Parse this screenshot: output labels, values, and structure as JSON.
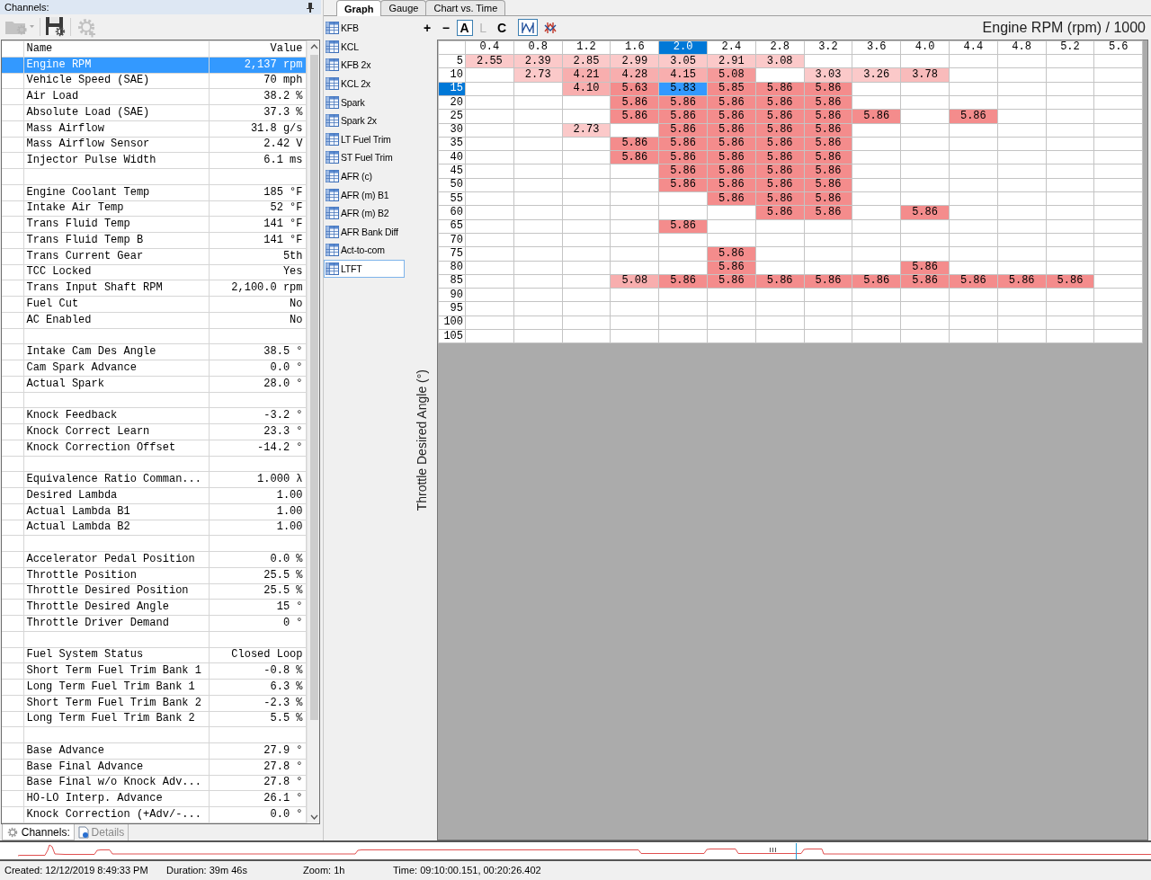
{
  "channels_panel": {
    "title": "Channels:",
    "toolbar": [
      {
        "kind": "folder",
        "disabled": true
      },
      {
        "kind": "save",
        "disabled": false
      },
      {
        "kind": "gear",
        "disabled": true
      }
    ],
    "columns": [
      "Name",
      "Value"
    ],
    "rows": [
      {
        "kind": "channel",
        "name": "Engine RPM",
        "value": "2,137 rpm",
        "selected": true
      },
      {
        "kind": "channel",
        "name": "Vehicle Speed (SAE)",
        "value": "70 mph",
        "selected": false
      },
      {
        "kind": "channel",
        "name": "Air Load",
        "value": "38.2 %",
        "selected": false
      },
      {
        "kind": "channel",
        "name": "Absolute Load (SAE)",
        "value": "37.3 %",
        "selected": false
      },
      {
        "kind": "channel",
        "name": "Mass Airflow",
        "value": "31.8 g/s",
        "selected": false
      },
      {
        "kind": "channel",
        "name": "Mass Airflow Sensor",
        "value": "2.42 V",
        "selected": false
      },
      {
        "kind": "channel",
        "name": "Injector Pulse Width",
        "value": "6.1 ms",
        "selected": false
      },
      {
        "kind": "spacer"
      },
      {
        "kind": "channel",
        "name": "Engine Coolant Temp",
        "value": "185 °F",
        "selected": false
      },
      {
        "kind": "channel",
        "name": "Intake Air Temp",
        "value": "52 °F",
        "selected": false
      },
      {
        "kind": "channel",
        "name": "Trans Fluid Temp",
        "value": "141 °F",
        "selected": false
      },
      {
        "kind": "channel",
        "name": "Trans Fluid Temp B",
        "value": "141 °F",
        "selected": false
      },
      {
        "kind": "channel",
        "name": "Trans Current Gear",
        "value": "5th",
        "selected": false
      },
      {
        "kind": "channel",
        "name": "TCC Locked",
        "value": "Yes",
        "selected": false
      },
      {
        "kind": "channel",
        "name": "Trans Input Shaft RPM",
        "value": "2,100.0 rpm",
        "selected": false
      },
      {
        "kind": "channel",
        "name": "Fuel Cut",
        "value": "No",
        "selected": false
      },
      {
        "kind": "channel",
        "name": "AC Enabled",
        "value": "No",
        "selected": false
      },
      {
        "kind": "spacer"
      },
      {
        "kind": "channel",
        "name": "Intake Cam Des Angle",
        "value": "38.5 °",
        "selected": false
      },
      {
        "kind": "channel",
        "name": "Cam Spark Advance",
        "value": "0.0 °",
        "selected": false
      },
      {
        "kind": "channel",
        "name": "Actual Spark",
        "value": "28.0 °",
        "selected": false
      },
      {
        "kind": "spacer"
      },
      {
        "kind": "channel",
        "name": "Knock Feedback",
        "value": "-3.2 °",
        "selected": false
      },
      {
        "kind": "channel",
        "name": "Knock Correct Learn",
        "value": "23.3 °",
        "selected": false
      },
      {
        "kind": "channel",
        "name": "Knock Correction Offset",
        "value": "-14.2 °",
        "selected": false
      },
      {
        "kind": "spacer"
      },
      {
        "kind": "channel",
        "name": "Equivalence Ratio Comman...",
        "value": "1.000 λ",
        "selected": false
      },
      {
        "kind": "channel",
        "name": "Desired Lambda",
        "value": "1.00",
        "selected": false
      },
      {
        "kind": "channel",
        "name": "Actual Lambda B1",
        "value": "1.00",
        "selected": false
      },
      {
        "kind": "channel",
        "name": "Actual Lambda B2",
        "value": "1.00",
        "selected": false
      },
      {
        "kind": "spacer"
      },
      {
        "kind": "channel",
        "name": "Accelerator Pedal Position",
        "value": "0.0 %",
        "selected": false
      },
      {
        "kind": "channel",
        "name": "Throttle Position",
        "value": "25.5 %",
        "selected": false
      },
      {
        "kind": "channel",
        "name": "Throttle Desired Position",
        "value": "25.5 %",
        "selected": false
      },
      {
        "kind": "channel",
        "name": "Throttle Desired Angle",
        "value": "15 °",
        "selected": false
      },
      {
        "kind": "channel",
        "name": "Throttle Driver Demand",
        "value": "0 °",
        "selected": false
      },
      {
        "kind": "spacer"
      },
      {
        "kind": "channel",
        "name": "Fuel System Status",
        "value": "Closed Loop",
        "selected": false
      },
      {
        "kind": "channel",
        "name": "Short Term Fuel Trim Bank 1",
        "value": "-0.8 %",
        "selected": false
      },
      {
        "kind": "channel",
        "name": "Long Term Fuel Trim Bank 1",
        "value": "6.3 %",
        "selected": false
      },
      {
        "kind": "channel",
        "name": "Short Term Fuel Trim Bank 2",
        "value": "-2.3 %",
        "selected": false
      },
      {
        "kind": "channel",
        "name": "Long Term Fuel Trim Bank 2",
        "value": "5.5 %",
        "selected": false
      },
      {
        "kind": "spacer"
      },
      {
        "kind": "channel",
        "name": "Base Advance",
        "value": "27.9 °",
        "selected": false
      },
      {
        "kind": "channel",
        "name": "Base Final Advance",
        "value": "27.8 °",
        "selected": false
      },
      {
        "kind": "channel",
        "name": "Base Final w/o Knock Adv...",
        "value": "27.8 °",
        "selected": false
      },
      {
        "kind": "channel",
        "name": "HO-LO Interp. Advance",
        "value": "26.1 °",
        "selected": false
      },
      {
        "kind": "channel",
        "name": "Knock Correction (+Adv/-...",
        "value": "0.0 °",
        "selected": false
      }
    ],
    "bottom_tabs": [
      {
        "label": "Channels:",
        "kind": "gear",
        "selected": true
      },
      {
        "label": "Details",
        "kind": "doc",
        "selected": false
      }
    ]
  },
  "view_tabs": [
    {
      "label": "Graph",
      "selected": true
    },
    {
      "label": "Gauge",
      "selected": false
    },
    {
      "label": "Chart vs. Time",
      "selected": false
    }
  ],
  "tables": [
    {
      "label": "KFB",
      "selected": false
    },
    {
      "label": "KCL",
      "selected": false
    },
    {
      "label": "KFB 2x",
      "selected": false
    },
    {
      "label": "KCL 2x",
      "selected": false
    },
    {
      "label": "Spark",
      "selected": false
    },
    {
      "label": "Spark 2x",
      "selected": false
    },
    {
      "label": "LT Fuel Trim",
      "selected": false
    },
    {
      "label": "ST Fuel Trim",
      "selected": false
    },
    {
      "label": "AFR (c)",
      "selected": false
    },
    {
      "label": "AFR (m) B1",
      "selected": false
    },
    {
      "label": "AFR (m) B2",
      "selected": false
    },
    {
      "label": "AFR Bank Diff",
      "selected": false
    },
    {
      "label": "Act-to-com",
      "selected": false
    },
    {
      "label": "LTFT",
      "selected": true
    }
  ],
  "graph_toolbar": [
    {
      "kind": "text",
      "label": "+",
      "selected": false,
      "disabled": false
    },
    {
      "kind": "text",
      "label": "−",
      "selected": false,
      "disabled": false
    },
    {
      "kind": "text",
      "label": "A",
      "selected": true,
      "disabled": false
    },
    {
      "kind": "text",
      "label": "L",
      "selected": false,
      "disabled": true
    },
    {
      "kind": "text",
      "label": "C",
      "selected": false,
      "disabled": false
    },
    {
      "kind": "lines",
      "selected": true
    },
    {
      "kind": "cross",
      "selected": false
    }
  ],
  "map": {
    "title": "Engine RPM (rpm) / 1000",
    "y_label": "Throttle Desired Angle (°)",
    "columns": [
      {
        "label": "0.4",
        "selected": false
      },
      {
        "label": "0.8",
        "selected": false
      },
      {
        "label": "1.2",
        "selected": false
      },
      {
        "label": "1.6",
        "selected": false
      },
      {
        "label": "2.0",
        "selected": true
      },
      {
        "label": "2.4",
        "selected": false
      },
      {
        "label": "2.8",
        "selected": false
      },
      {
        "label": "3.2",
        "selected": false
      },
      {
        "label": "3.6",
        "selected": false
      },
      {
        "label": "4.0",
        "selected": false
      },
      {
        "label": "4.4",
        "selected": false
      },
      {
        "label": "4.8",
        "selected": false
      },
      {
        "label": "5.2",
        "selected": false
      },
      {
        "label": "5.6",
        "selected": false
      }
    ],
    "rows": [
      {
        "label": "5",
        "selected": false,
        "cells": [
          {
            "text": "2.55",
            "color": "#fbc9c9"
          },
          {
            "text": "2.39",
            "color": "#fbc9c9"
          },
          {
            "text": "2.85",
            "color": "#fbc9c9"
          },
          {
            "text": "2.99",
            "color": "#fbc9c9"
          },
          {
            "text": "3.05",
            "color": "#fbc9c9"
          },
          {
            "text": "2.91",
            "color": "#fbc9c9"
          },
          {
            "text": "3.08",
            "color": "#fbc9c9"
          },
          null,
          null,
          null,
          null,
          null,
          null,
          null
        ]
      },
      {
        "label": "10",
        "selected": false,
        "cells": [
          null,
          {
            "text": "2.73",
            "color": "#fbc9c9"
          },
          {
            "text": "4.21",
            "color": "#f8aeae"
          },
          {
            "text": "4.28",
            "color": "#f8aeae"
          },
          {
            "text": "4.15",
            "color": "#f8aeae"
          },
          {
            "text": "5.08",
            "color": "#f59a9a"
          },
          null,
          {
            "text": "3.03",
            "color": "#fbc9c9"
          },
          {
            "text": "3.26",
            "color": "#fbc9c9"
          },
          {
            "text": "3.78",
            "color": "#f9bbbb"
          },
          null,
          null,
          null,
          null
        ]
      },
      {
        "label": "15",
        "selected": true,
        "cells": [
          null,
          null,
          {
            "text": "4.10",
            "color": "#f8aeae"
          },
          {
            "text": "5.63",
            "color": "#f48c8c"
          },
          {
            "text": "5.83",
            "color": "#3399ff"
          },
          {
            "text": "5.85",
            "color": "#f48c8c"
          },
          {
            "text": "5.86",
            "color": "#f48c8c"
          },
          {
            "text": "5.86",
            "color": "#f48c8c"
          },
          null,
          null,
          null,
          null,
          null,
          null
        ]
      },
      {
        "label": "20",
        "selected": false,
        "cells": [
          null,
          null,
          null,
          {
            "text": "5.86",
            "color": "#f48c8c"
          },
          {
            "text": "5.86",
            "color": "#f48c8c"
          },
          {
            "text": "5.86",
            "color": "#f48c8c"
          },
          {
            "text": "5.86",
            "color": "#f48c8c"
          },
          {
            "text": "5.86",
            "color": "#f48c8c"
          },
          null,
          null,
          null,
          null,
          null,
          null
        ]
      },
      {
        "label": "25",
        "selected": false,
        "cells": [
          null,
          null,
          null,
          {
            "text": "5.86",
            "color": "#f48c8c"
          },
          {
            "text": "5.86",
            "color": "#f48c8c"
          },
          {
            "text": "5.86",
            "color": "#f48c8c"
          },
          {
            "text": "5.86",
            "color": "#f48c8c"
          },
          {
            "text": "5.86",
            "color": "#f48c8c"
          },
          {
            "text": "5.86",
            "color": "#f48c8c"
          },
          null,
          {
            "text": "5.86",
            "color": "#f48c8c"
          },
          null,
          null,
          null
        ]
      },
      {
        "label": "30",
        "selected": false,
        "cells": [
          null,
          null,
          {
            "text": "2.73",
            "color": "#fbc9c9"
          },
          null,
          {
            "text": "5.86",
            "color": "#f48c8c"
          },
          {
            "text": "5.86",
            "color": "#f48c8c"
          },
          {
            "text": "5.86",
            "color": "#f48c8c"
          },
          {
            "text": "5.86",
            "color": "#f48c8c"
          },
          null,
          null,
          null,
          null,
          null,
          null
        ]
      },
      {
        "label": "35",
        "selected": false,
        "cells": [
          null,
          null,
          null,
          {
            "text": "5.86",
            "color": "#f48c8c"
          },
          {
            "text": "5.86",
            "color": "#f48c8c"
          },
          {
            "text": "5.86",
            "color": "#f48c8c"
          },
          {
            "text": "5.86",
            "color": "#f48c8c"
          },
          {
            "text": "5.86",
            "color": "#f48c8c"
          },
          null,
          null,
          null,
          null,
          null,
          null
        ]
      },
      {
        "label": "40",
        "selected": false,
        "cells": [
          null,
          null,
          null,
          {
            "text": "5.86",
            "color": "#f48c8c"
          },
          {
            "text": "5.86",
            "color": "#f48c8c"
          },
          {
            "text": "5.86",
            "color": "#f48c8c"
          },
          {
            "text": "5.86",
            "color": "#f48c8c"
          },
          {
            "text": "5.86",
            "color": "#f48c8c"
          },
          null,
          null,
          null,
          null,
          null,
          null
        ]
      },
      {
        "label": "45",
        "selected": false,
        "cells": [
          null,
          null,
          null,
          null,
          {
            "text": "5.86",
            "color": "#f48c8c"
          },
          {
            "text": "5.86",
            "color": "#f48c8c"
          },
          {
            "text": "5.86",
            "color": "#f48c8c"
          },
          {
            "text": "5.86",
            "color": "#f48c8c"
          },
          null,
          null,
          null,
          null,
          null,
          null
        ]
      },
      {
        "label": "50",
        "selected": false,
        "cells": [
          null,
          null,
          null,
          null,
          {
            "text": "5.86",
            "color": "#f48c8c"
          },
          {
            "text": "5.86",
            "color": "#f48c8c"
          },
          {
            "text": "5.86",
            "color": "#f48c8c"
          },
          {
            "text": "5.86",
            "color": "#f48c8c"
          },
          null,
          null,
          null,
          null,
          null,
          null
        ]
      },
      {
        "label": "55",
        "selected": false,
        "cells": [
          null,
          null,
          null,
          null,
          null,
          {
            "text": "5.86",
            "color": "#f48c8c"
          },
          {
            "text": "5.86",
            "color": "#f48c8c"
          },
          {
            "text": "5.86",
            "color": "#f48c8c"
          },
          null,
          null,
          null,
          null,
          null,
          null
        ]
      },
      {
        "label": "60",
        "selected": false,
        "cells": [
          null,
          null,
          null,
          null,
          null,
          null,
          {
            "text": "5.86",
            "color": "#f48c8c"
          },
          {
            "text": "5.86",
            "color": "#f48c8c"
          },
          null,
          {
            "text": "5.86",
            "color": "#f48c8c"
          },
          null,
          null,
          null,
          null
        ]
      },
      {
        "label": "65",
        "selected": false,
        "cells": [
          null,
          null,
          null,
          null,
          {
            "text": "5.86",
            "color": "#f48c8c"
          },
          null,
          null,
          null,
          null,
          null,
          null,
          null,
          null,
          null
        ]
      },
      {
        "label": "70",
        "selected": false,
        "cells": [
          null,
          null,
          null,
          null,
          null,
          null,
          null,
          null,
          null,
          null,
          null,
          null,
          null,
          null
        ]
      },
      {
        "label": "75",
        "selected": false,
        "cells": [
          null,
          null,
          null,
          null,
          null,
          {
            "text": "5.86",
            "color": "#f48c8c"
          },
          null,
          null,
          null,
          null,
          null,
          null,
          null,
          null
        ]
      },
      {
        "label": "80",
        "selected": false,
        "cells": [
          null,
          null,
          null,
          null,
          null,
          {
            "text": "5.86",
            "color": "#f48c8c"
          },
          null,
          null,
          null,
          {
            "text": "5.86",
            "color": "#f48c8c"
          },
          null,
          null,
          null,
          null
        ]
      },
      {
        "label": "85",
        "selected": false,
        "cells": [
          null,
          null,
          null,
          {
            "text": "5.08",
            "color": "#f8aeae"
          },
          {
            "text": "5.86",
            "color": "#f48c8c"
          },
          {
            "text": "5.86",
            "color": "#f48c8c"
          },
          {
            "text": "5.86",
            "color": "#f48c8c"
          },
          {
            "text": "5.86",
            "color": "#f48c8c"
          },
          {
            "text": "5.86",
            "color": "#f48c8c"
          },
          {
            "text": "5.86",
            "color": "#f48c8c"
          },
          {
            "text": "5.86",
            "color": "#f48c8c"
          },
          {
            "text": "5.86",
            "color": "#f48c8c"
          },
          {
            "text": "5.86",
            "color": "#f48c8c"
          },
          null
        ]
      },
      {
        "label": "90",
        "selected": false,
        "cells": [
          null,
          null,
          null,
          null,
          null,
          null,
          null,
          null,
          null,
          null,
          null,
          null,
          null,
          null
        ]
      },
      {
        "label": "95",
        "selected": false,
        "cells": [
          null,
          null,
          null,
          null,
          null,
          null,
          null,
          null,
          null,
          null,
          null,
          null,
          null,
          null
        ]
      },
      {
        "label": "100",
        "selected": false,
        "cells": [
          null,
          null,
          null,
          null,
          null,
          null,
          null,
          null,
          null,
          null,
          null,
          null,
          null,
          null
        ]
      },
      {
        "label": "105",
        "selected": false,
        "cells": [
          null,
          null,
          null,
          null,
          null,
          null,
          null,
          null,
          null,
          null,
          null,
          null,
          null,
          null
        ]
      }
    ]
  },
  "status_bar": [
    "Created: 12/12/2019 8:49:33 PM",
    "Duration: 39m 46s",
    "Zoom: 1h",
    "Time: 09:10:00.151, 00:20:26.402"
  ]
}
